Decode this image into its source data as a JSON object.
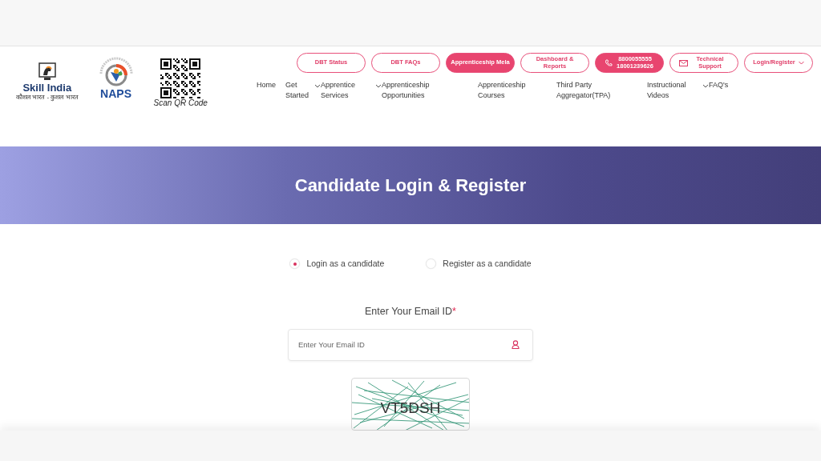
{
  "logos": {
    "skill_india": {
      "name": "Skill India",
      "tagline": "कौशल भारत - कुशल भारत"
    },
    "naps": {
      "name": "NAPS"
    },
    "qr": {
      "caption": "Scan QR Code"
    }
  },
  "top_buttons": [
    {
      "kind": "outline",
      "label": "DBT Status"
    },
    {
      "kind": "outline",
      "label": "DBT FAQs"
    },
    {
      "kind": "filled",
      "label": "Apprenticeship Mela"
    },
    {
      "kind": "outline",
      "label": "Dashboard & Reports"
    },
    {
      "kind": "phone",
      "label": "8800055555 18001239626"
    },
    {
      "kind": "mail",
      "label": "Technical Support"
    },
    {
      "kind": "dropdown",
      "label": "Login/Register"
    }
  ],
  "nav": [
    {
      "label": "Home",
      "dropdown": false
    },
    {
      "label": "Get Started",
      "dropdown": false
    },
    {
      "label": "Apprentice Services",
      "dropdown": true
    },
    {
      "label": "Apprenticeship Opportunities",
      "dropdown": true
    },
    {
      "label": "Apprenticeship Courses",
      "dropdown": false
    },
    {
      "label": "Third Party Aggregator(TPA)",
      "dropdown": false
    },
    {
      "label": "Instructional Videos",
      "dropdown": false
    },
    {
      "label": "FAQ's",
      "dropdown": true
    }
  ],
  "banner": {
    "title": "Candidate Login & Register"
  },
  "mode_options": [
    {
      "label": "Login as a candidate",
      "selected": true
    },
    {
      "label": "Register as a candidate",
      "selected": false
    }
  ],
  "email": {
    "label": "Enter Your Email ID",
    "required_mark": "*",
    "placeholder": "Enter Your Email ID"
  },
  "captcha": {
    "text": "VT5DSH"
  }
}
